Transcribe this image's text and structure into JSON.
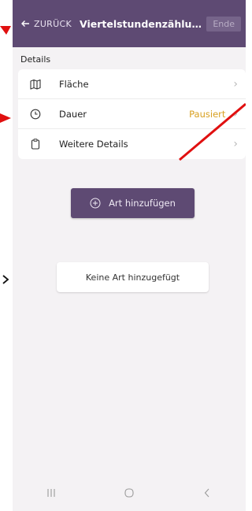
{
  "header": {
    "back_label": "ZURÜCK",
    "title": "Viertelstundenzählun...",
    "end_label": "Ende"
  },
  "details": {
    "section_label": "Details",
    "rows": [
      {
        "label": "Fläche",
        "icon": "map-icon",
        "status": ""
      },
      {
        "label": "Dauer",
        "icon": "clock-icon",
        "status": "Pausiert"
      },
      {
        "label": "Weitere Details",
        "icon": "clipboard-icon",
        "status": ""
      }
    ]
  },
  "add_species_label": "Art hinzufügen",
  "empty_message": "Keine Art hinzugefügt",
  "colors": {
    "primary": "#5e4a73",
    "status": "#d8a020",
    "annotation": "#e01010"
  }
}
